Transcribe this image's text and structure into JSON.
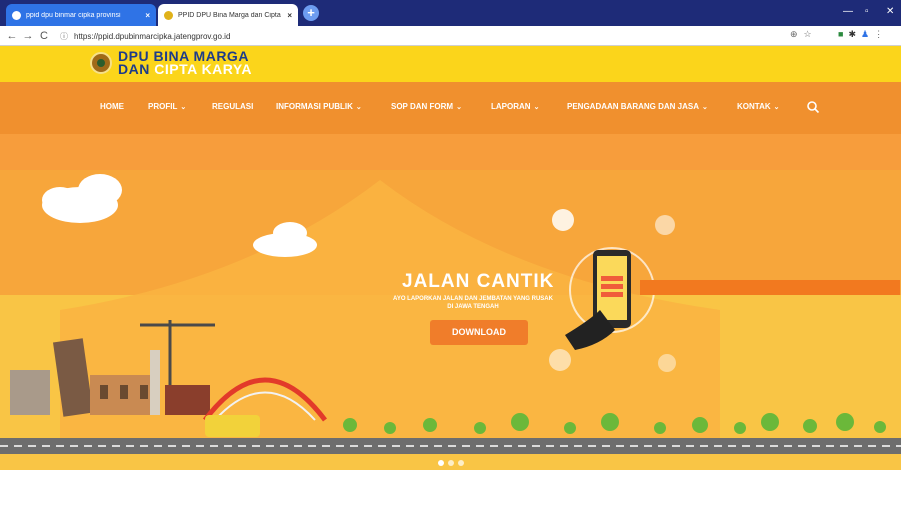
{
  "browser": {
    "tabs": [
      {
        "label": "ppid dpu binmar cipka provinsi"
      },
      {
        "label": "PPID DPU Bina Marga dan Cipta"
      }
    ],
    "url": "https://ppid.dpubinmarcipka.jatengprov.go.id"
  },
  "site": {
    "logo_line1_a": "DPU",
    "logo_line1_b": "BINA MARGA",
    "logo_line2_a": "DAN",
    "logo_line2_b": "CIPTA KARYA"
  },
  "nav": [
    {
      "label": "HOME",
      "dropdown": false
    },
    {
      "label": "PROFIL",
      "dropdown": true
    },
    {
      "label": "REGULASI",
      "dropdown": false
    },
    {
      "label": "INFORMASI PUBLIK",
      "dropdown": true
    },
    {
      "label": "SOP DAN FORM",
      "dropdown": true
    },
    {
      "label": "LAPORAN",
      "dropdown": true
    },
    {
      "label": "PENGADAAN BARANG DAN JASA",
      "dropdown": true
    },
    {
      "label": "KONTAK",
      "dropdown": true
    }
  ],
  "slide": {
    "title": "JALAN CANTIK",
    "subtitle": "AYO LAPORKAN JALAN DAN JEMBATAN YANG RUSAK DI JAWA TENGAH",
    "button": "DOWNLOAD"
  },
  "colors": {
    "topbar": "#fbd51b",
    "nav": "#f0902e",
    "accent": "#f07d2a",
    "logo_blue": "#1d3b8a"
  },
  "icons": [
    "search-icon",
    "reload-icon",
    "back-icon",
    "forward-icon",
    "zoom-icon",
    "star-icon"
  ]
}
